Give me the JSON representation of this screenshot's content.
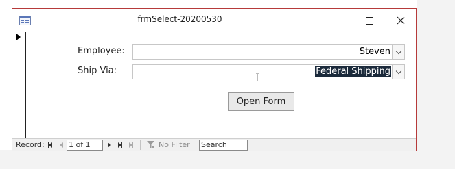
{
  "window": {
    "title": "frmSelect-20200530"
  },
  "form": {
    "employee_label": "Employee:",
    "employee_value": "Steven",
    "ship_via_label": "Ship Via:",
    "ship_via_value": "Federal Shipping",
    "open_form_label": "Open Form"
  },
  "navigation": {
    "record_label": "Record:",
    "record_position": "1 of 1",
    "filter_status": "No Filter",
    "search_placeholder": "Search"
  },
  "colors": {
    "window_border": "#b63a3a",
    "selection_bg": "#1b2a3b"
  }
}
